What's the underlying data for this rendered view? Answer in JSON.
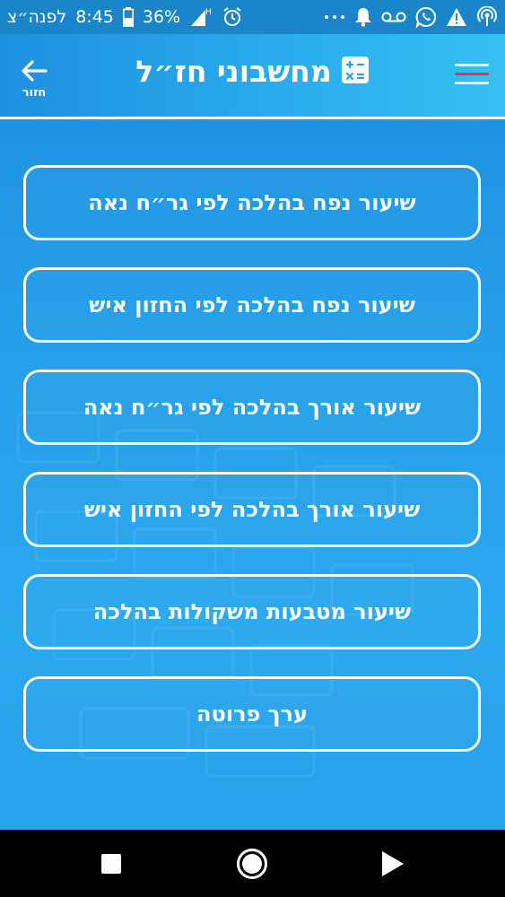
{
  "status_bar": {
    "carrier_text": "לפנה״צ",
    "time": "8:45",
    "battery_percent": "36%",
    "network": "H+",
    "icons_left": [
      "battery-icon",
      "signal-icon",
      "alarm-icon"
    ],
    "icons_right": [
      "more-dots-icon",
      "bell-icon",
      "voicemail-icon",
      "whatsapp-icon",
      "warning-icon",
      "hotspot-icon"
    ]
  },
  "header": {
    "title": "מחשבוני חז״ל",
    "back_label": "חזור",
    "title_icon": "calculator-icon",
    "menu_icon": "hamburger-menu-icon",
    "back_icon": "arrow-left-icon",
    "menu_accent_color": "#e53935"
  },
  "menu": {
    "items": [
      {
        "label": "שיעור נפח בהלכה לפי גר״ח נאה"
      },
      {
        "label": "שיעור נפח בהלכה לפי החזון איש"
      },
      {
        "label": "שיעור אורך בהלכה לפי גר״ח נאה"
      },
      {
        "label": "שיעור אורך בהלכה לפי החזון איש"
      },
      {
        "label": "שיעור מטבעות משקולות בהלכה"
      },
      {
        "label": "ערך פרוטה"
      }
    ]
  },
  "nav_bar": {
    "icons": [
      "recents-square-icon",
      "home-circle-icon",
      "back-triangle-icon"
    ]
  },
  "colors": {
    "background": "#259ee8",
    "status_bar": "#1a86c9",
    "foreground": "#ffffff"
  }
}
